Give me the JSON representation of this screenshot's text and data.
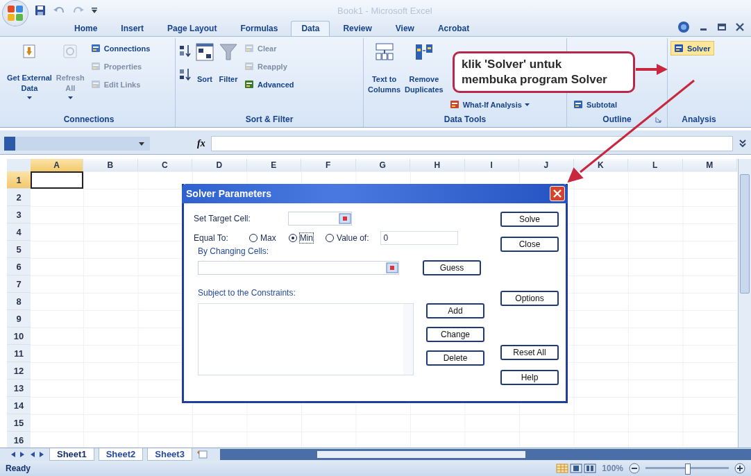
{
  "window": {
    "title": "Book1 - Microsoft Excel"
  },
  "tabs": [
    {
      "label": "Home",
      "selected": false
    },
    {
      "label": "Insert",
      "selected": false
    },
    {
      "label": "Page Layout",
      "selected": false
    },
    {
      "label": "Formulas",
      "selected": false
    },
    {
      "label": "Data",
      "selected": true
    },
    {
      "label": "Review",
      "selected": false
    },
    {
      "label": "View",
      "selected": false
    },
    {
      "label": "Acrobat",
      "selected": false
    }
  ],
  "ribbon": [
    {
      "label": "Connections",
      "items": [
        {
          "kind": "large",
          "lines": [
            "Get External",
            "Data"
          ],
          "dropdown": true,
          "disabled": false
        },
        {
          "kind": "large",
          "lines": [
            "Refresh",
            "All"
          ],
          "dropdown": true,
          "disabled": true
        },
        {
          "kind": "stack",
          "entries": [
            {
              "label": "Connections",
              "disabled": false,
              "dropdown": false,
              "highlighted": false
            },
            {
              "label": "Properties",
              "disabled": true,
              "dropdown": false,
              "highlighted": false
            },
            {
              "label": "Edit Links",
              "disabled": true,
              "dropdown": false,
              "highlighted": false
            }
          ]
        }
      ]
    },
    {
      "label": "Sort & Filter",
      "items": [
        {
          "kind": "sort-pair"
        },
        {
          "kind": "large",
          "lines": [
            "Sort"
          ],
          "dropdown": false,
          "disabled": false
        },
        {
          "kind": "large",
          "lines": [
            "Filter"
          ],
          "dropdown": false,
          "disabled": false
        },
        {
          "kind": "stack",
          "entries": [
            {
              "label": "Clear",
              "disabled": true,
              "dropdown": false,
              "highlighted": false
            },
            {
              "label": "Reapply",
              "disabled": true,
              "dropdown": false,
              "highlighted": false
            },
            {
              "label": "Advanced",
              "disabled": false,
              "dropdown": false,
              "highlighted": false
            }
          ]
        }
      ]
    },
    {
      "label": "Data Tools",
      "items": [
        {
          "kind": "large",
          "lines": [
            "Text to",
            "Columns"
          ],
          "dropdown": false,
          "disabled": false
        },
        {
          "kind": "large",
          "lines": [
            "Remove",
            "Duplicates"
          ],
          "dropdown": false,
          "disabled": false
        },
        {
          "kind": "stack",
          "entries": [
            {
              "label": "What-If Analysis",
              "disabled": false,
              "dropdown": true,
              "highlighted": false
            }
          ]
        }
      ]
    },
    {
      "label": "Outline",
      "launcher": true,
      "items": [
        {
          "kind": "stack",
          "entries": [
            {
              "label": "Subtotal",
              "disabled": false,
              "dropdown": false,
              "highlighted": false
            }
          ]
        }
      ]
    },
    {
      "label": "Analysis",
      "items": [
        {
          "kind": "stack",
          "entries": [
            {
              "label": "Solver",
              "disabled": false,
              "dropdown": false,
              "highlighted": true
            }
          ]
        }
      ]
    }
  ],
  "callout": {
    "text": "klik 'Solver' untuk membuka program Solver"
  },
  "formula_bar": {
    "function_label": "fx"
  },
  "columns": [
    {
      "label": "A",
      "selected": true
    },
    {
      "label": "B",
      "selected": false
    },
    {
      "label": "C",
      "selected": false
    },
    {
      "label": "D",
      "selected": false
    },
    {
      "label": "E",
      "selected": false
    },
    {
      "label": "F",
      "selected": false
    },
    {
      "label": "G",
      "selected": false
    },
    {
      "label": "H",
      "selected": false
    },
    {
      "label": "I",
      "selected": false
    },
    {
      "label": "J",
      "selected": false
    },
    {
      "label": "K",
      "selected": false
    },
    {
      "label": "L",
      "selected": false
    },
    {
      "label": "M",
      "selected": false
    }
  ],
  "rows": [
    {
      "label": "1",
      "selected": true
    },
    {
      "label": "2",
      "selected": false
    },
    {
      "label": "3",
      "selected": false
    },
    {
      "label": "4",
      "selected": false
    },
    {
      "label": "5",
      "selected": false
    },
    {
      "label": "6",
      "selected": false
    },
    {
      "label": "7",
      "selected": false
    },
    {
      "label": "8",
      "selected": false
    },
    {
      "label": "9",
      "selected": false
    },
    {
      "label": "10",
      "selected": false
    },
    {
      "label": "11",
      "selected": false
    },
    {
      "label": "12",
      "selected": false
    },
    {
      "label": "13",
      "selected": false
    },
    {
      "label": "14",
      "selected": false
    },
    {
      "label": "15",
      "selected": false
    },
    {
      "label": "16",
      "selected": false
    }
  ],
  "dialog": {
    "title": "Solver Parameters",
    "target_label": "Set Target Cell:",
    "equal_label": "Equal To:",
    "options": [
      {
        "label": "Max",
        "selected": false
      },
      {
        "label": "Min",
        "selected": true
      },
      {
        "label": "Value of:",
        "selected": false
      }
    ],
    "value_of": "0",
    "changing_label": "By Changing Cells:",
    "guess_button": "Guess",
    "constraints_label": "Subject to the Constraints:",
    "constraint_buttons": [
      "Add",
      "Change",
      "Delete"
    ],
    "side_buttons": [
      "Solve",
      "Close",
      "Options",
      "Reset All",
      "Help"
    ]
  },
  "sheet_tabs": [
    {
      "label": "Sheet1",
      "selected": true
    },
    {
      "label": "Sheet2",
      "selected": false
    },
    {
      "label": "Sheet3",
      "selected": false
    }
  ],
  "status_bar": {
    "text": "Ready",
    "zoom": "100%",
    "level": 0.5
  }
}
